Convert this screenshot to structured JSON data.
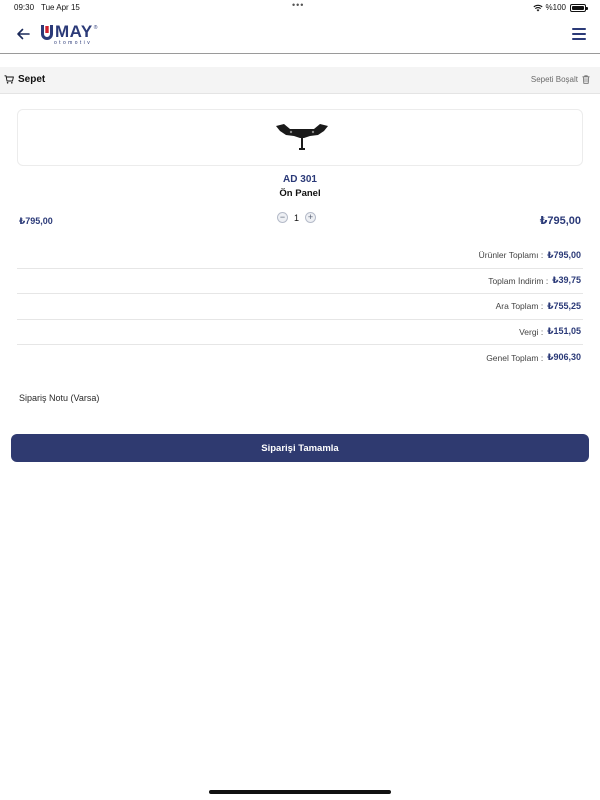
{
  "status_bar": {
    "time": "09:30",
    "date": "Tue Apr 15",
    "dots": "•••",
    "battery": "%100"
  },
  "header": {
    "logo_text": "MAY",
    "logo_sub": "otomotiv",
    "logo_reg": "®"
  },
  "cart": {
    "title": "Sepet",
    "empty_label": "Sepeti Boşalt"
  },
  "product": {
    "code": "AD 301",
    "name": "Ön Panel",
    "unit_price": "₺795,00",
    "quantity": "1",
    "decrease": "−",
    "increase": "+",
    "line_total": "₺795,00"
  },
  "summary": [
    {
      "label": "Ürünler Toplamı :",
      "value": "₺795,00"
    },
    {
      "label": "Toplam İndirim :",
      "value": "₺39,75"
    },
    {
      "label": "Ara Toplam :",
      "value": "₺755,25"
    },
    {
      "label": "Vergi :",
      "value": "₺151,05"
    },
    {
      "label": "Genel Toplam :",
      "value": "₺906,30"
    }
  ],
  "order_note": "Sipariş Notu (Varsa)",
  "complete_button": "Siparişi Tamamla",
  "colors": {
    "brand": "#2b3a78",
    "button": "#2f3a70"
  }
}
